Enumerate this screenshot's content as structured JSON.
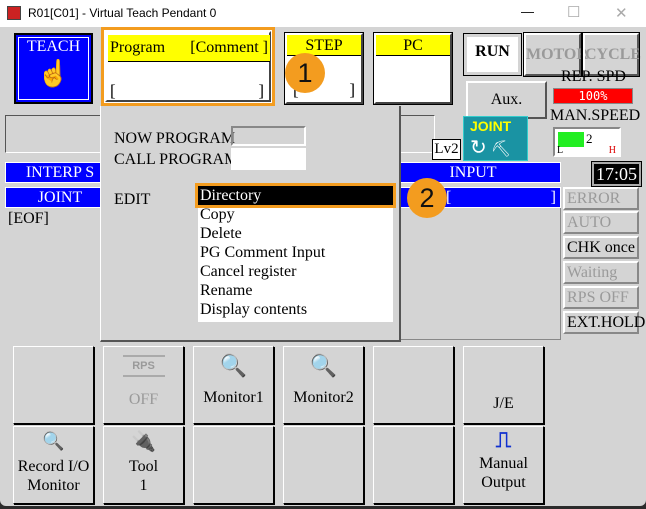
{
  "window": {
    "title": "R01[C01] - Virtual Teach Pendant 0",
    "minimize": "—",
    "maximize": "☐",
    "close": "✕"
  },
  "mode": {
    "label": "TEACH",
    "icon": "hand-pointer-icon"
  },
  "program": {
    "header_left": "Program",
    "header_right": "[Comment ]",
    "value": "",
    "bracket_open": "[",
    "bracket_close": "]"
  },
  "step": {
    "header": "STEP",
    "bracket_open": "[",
    "bracket_close": "]"
  },
  "pc": {
    "header": "PC"
  },
  "run_buttons": {
    "run": "RUN",
    "motor": "MOTOR",
    "cycle": "CYCLE"
  },
  "aux": "Aux.",
  "rep_spd": {
    "label": "REP. SPD",
    "value": "100%",
    "color": "#ff0000"
  },
  "man_speed": {
    "label": "MAN.SPEED",
    "level": "2",
    "low": "L",
    "high": "H",
    "fill_fraction": 0.4
  },
  "level": "Lv2",
  "joint_icon": {
    "label": "JOINT",
    "color": "#1a93a3"
  },
  "interp_bar": "INTERP S",
  "joint_bar": "JOINT",
  "input_bar": "INPUT",
  "input_field": {
    "open": "[",
    "close": "]"
  },
  "clock": "17:05",
  "eof": "[EOF]",
  "status": [
    {
      "label": "ERROR",
      "enabled": false
    },
    {
      "label": "AUTO",
      "enabled": false
    },
    {
      "label": "CHK once",
      "enabled": true
    },
    {
      "label": "Waiting",
      "enabled": false
    },
    {
      "label": "RPS OFF",
      "enabled": false
    },
    {
      "label": "EXT.HOLD",
      "enabled": true
    }
  ],
  "popup": {
    "now_program": "NOW PROGRAM",
    "call_program": "CALL PROGRAM",
    "edit": "EDIT",
    "items": [
      "Directory",
      "Copy",
      "Delete",
      "PG Comment Input",
      "Cancel register",
      "Rename",
      "Display contents"
    ],
    "selected": 0
  },
  "badges": [
    "1",
    "2"
  ],
  "accent": "#f39c1f",
  "function_keys": {
    "row1": [
      {
        "label": ""
      },
      {
        "label": "OFF",
        "icon": "rps-icon",
        "icon_text": "RPS",
        "enabled": false
      },
      {
        "label": "Monitor1",
        "icon": "monitor-search-icon"
      },
      {
        "label": "Monitor2",
        "icon": "monitor-search-icon"
      },
      {
        "label": ""
      },
      {
        "label": "J/E"
      }
    ],
    "row2": [
      {
        "label": "Record I/O",
        "label2": "Monitor",
        "icon": "record-search-icon"
      },
      {
        "label": "Tool",
        "label2": "1",
        "icon": "tool-icon"
      },
      {
        "label": ""
      },
      {
        "label": ""
      },
      {
        "label": ""
      },
      {
        "label": "Manual",
        "label2": "Output",
        "icon": "pulse-icon"
      }
    ]
  }
}
